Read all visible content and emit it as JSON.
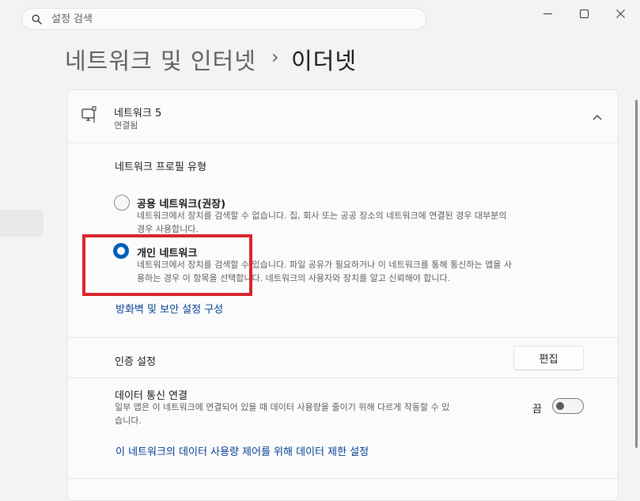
{
  "search": {
    "placeholder": "설정 검색"
  },
  "breadcrumb": {
    "parent": "네트워크 및 인터넷",
    "separator": "›",
    "current": "이더넷"
  },
  "network": {
    "name": "네트워크 5",
    "status": "연결됨"
  },
  "profile": {
    "title": "네트워크 프로필 유형",
    "options": [
      {
        "label": "공용 네트워크(권장)",
        "desc1": "네트워크에서 장치를 검색할 수 없습니다. 집, 회사 또는 공공 장소의 네트워크에 연결된 경우 대부분의",
        "desc2": "경우 사용합니다.",
        "selected": false
      },
      {
        "label": "개인 네트워크",
        "desc1": "네트워크에서 장치를 검색할 수 있습니다. 파일 공유가 필요하거나 이 네트워크를 통해 통신하는 앱을 사",
        "desc2": "용하는 경우 이 항목을 선택합니다. 네트워크의 사용자와 장치를 알고 신뢰해야 합니다.",
        "selected": true
      }
    ],
    "firewall_link": "방화벽 및 보안 설정 구성"
  },
  "auth": {
    "label": "인증 설정",
    "button": "편집"
  },
  "metered": {
    "label": "데이터 통신 연결",
    "desc1": "일부 앱은 이 네트워크에 연결되어 있을 때 데이터 사용량을 줄이기 위해 다르게 작동할 수 있",
    "desc2": "습니다.",
    "state": "끔",
    "on": false,
    "limit_link": "이 네트워크의 데이터 사용량 제어를 위해 데이터 제한 설정"
  },
  "colors": {
    "accent": "#005fb8",
    "link": "#003e92",
    "highlight": "#d9262b"
  },
  "icons": [
    "search-icon",
    "minimize-icon",
    "maximize-icon",
    "close-icon",
    "ethernet-computer-icon",
    "chevron-up-icon"
  ]
}
